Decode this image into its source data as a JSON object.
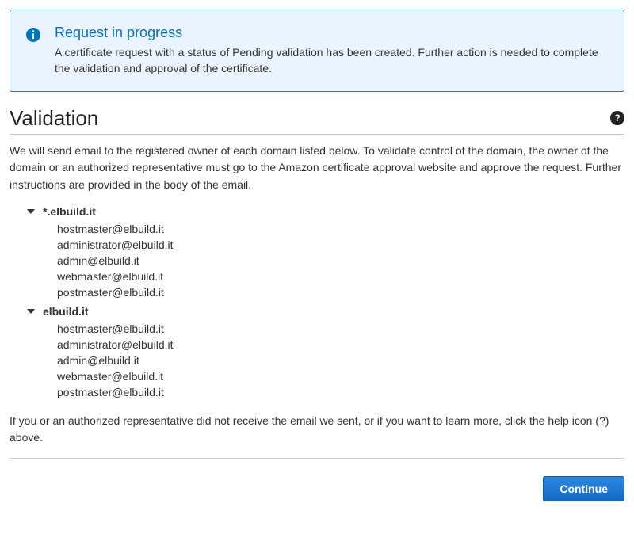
{
  "alert": {
    "title": "Request in progress",
    "text": "A certificate request with a status of Pending validation has been created. Further action is needed to complete the validation and approval of the certificate."
  },
  "section": {
    "heading": "Validation",
    "help_symbol": "?",
    "intro": "We will send email to the registered owner of each domain listed below. To validate control of the domain, the owner of the domain or an authorized representative must go to the Amazon certificate approval website and approve the request. Further instructions are provided in the body of the email.",
    "footer": "If you or an authorized representative did not receive the email we sent, or if you want to learn more, click the help icon (?) above."
  },
  "domains": [
    {
      "name": "*.elbuild.it",
      "emails": [
        "hostmaster@elbuild.it",
        "administrator@elbuild.it",
        "admin@elbuild.it",
        "webmaster@elbuild.it",
        "postmaster@elbuild.it"
      ]
    },
    {
      "name": "elbuild.it",
      "emails": [
        "hostmaster@elbuild.it",
        "administrator@elbuild.it",
        "admin@elbuild.it",
        "webmaster@elbuild.it",
        "postmaster@elbuild.it"
      ]
    }
  ],
  "buttons": {
    "continue": "Continue"
  }
}
